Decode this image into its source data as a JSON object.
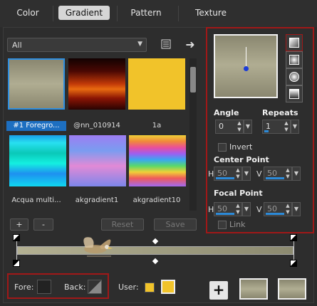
{
  "tabs": [
    "Color",
    "Gradient",
    "Pattern",
    "Texture"
  ],
  "active_tab": "Gradient",
  "category_dropdown": {
    "value": "All"
  },
  "swatches": [
    {
      "label": "#1 Foregro...",
      "selected": true,
      "gradient": "linear-gradient(180deg,#8a8770 0%,#b0ad92 50%,#8a8770 100%)"
    },
    {
      "label": "@nn_010914",
      "selected": false,
      "gradient": "linear-gradient(180deg,#120202 0%,#4a0803 25%,#c23a08 50%,#e86a10 60%,#8a1404 78%,#2a0402 100%)"
    },
    {
      "label": "1a",
      "selected": false,
      "gradient": "linear-gradient(180deg,#f1c32a 0%,#f1c32a 100%)"
    },
    {
      "label": "Acqua multi...",
      "selected": false,
      "gradient": "linear-gradient(180deg,#1a9fe8 0%,#28e0f0 15%,#0ac8b8 35%,#14f0e0 55%,#1e90f0 75%,#10d8f0 100%)"
    },
    {
      "label": "akgradient1",
      "selected": false,
      "gradient": "linear-gradient(180deg,#9d7df2 0%,#7a9cf0 30%,#e18ad6 60%,#7c86ea 100%)"
    },
    {
      "label": "akgradient10",
      "selected": false,
      "gradient": "linear-gradient(180deg,#f0d038 0%,#f08a3a 12%,#ea4e9a 24%,#9e5ef0 36%,#3aa8f0 48%,#5ad86a 60%,#f0d038 72%,#f05a5a 84%,#a06af0 100%)"
    }
  ],
  "buttons": {
    "add": "+",
    "remove": "-",
    "reset": "Reset",
    "save": "Save"
  },
  "angle": {
    "label": "Angle",
    "value": "0"
  },
  "repeats": {
    "label": "Repeats",
    "value": "1"
  },
  "invert": {
    "label": "Invert",
    "checked": false
  },
  "center_point": {
    "label": "Center Point",
    "h_label": "H",
    "h_value": "50",
    "v_label": "V",
    "v_value": "50"
  },
  "focal_point": {
    "label": "Focal Point",
    "h_label": "H",
    "h_value": "50",
    "v_label": "V",
    "v_value": "50"
  },
  "link": {
    "label": "Link",
    "checked": false
  },
  "fore_label": "Fore:",
  "back_label": "Back:",
  "user_label": "User:",
  "colors": {
    "accent": "#1d6fc1",
    "highlight_border": "#a01818",
    "user_color": "#f1c32a"
  }
}
